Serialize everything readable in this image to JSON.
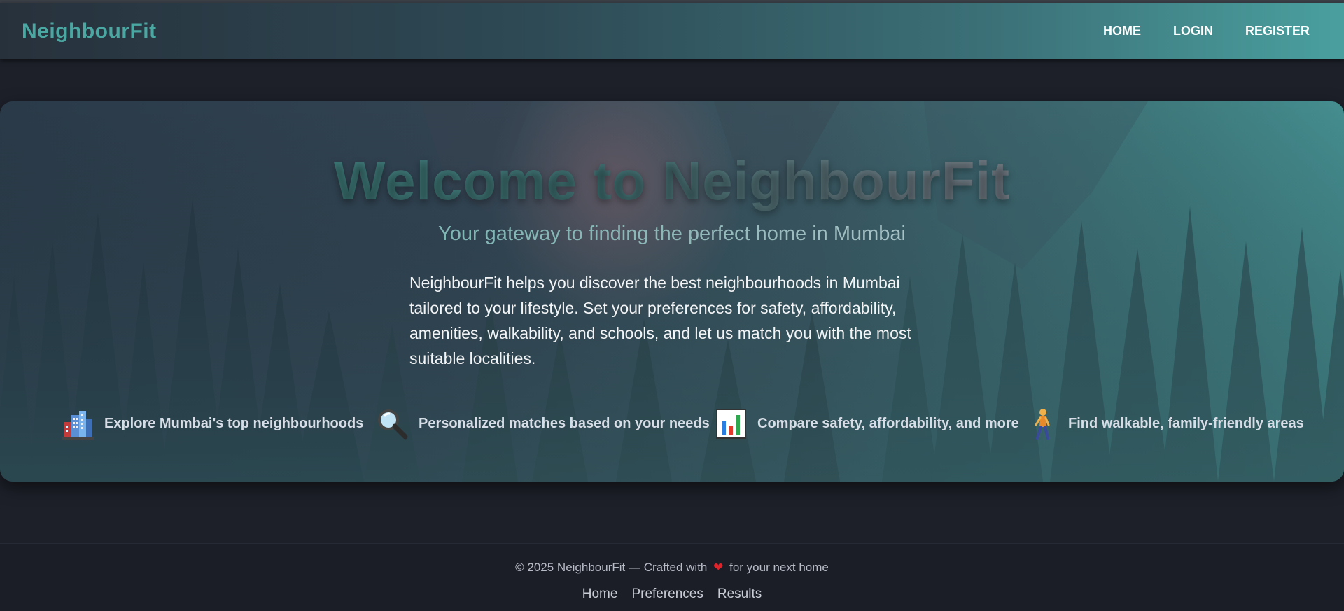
{
  "navbar": {
    "brand": "NeighbourFit",
    "links": [
      "HOME",
      "LOGIN",
      "REGISTER"
    ]
  },
  "hero": {
    "title": "Welcome to NeighbourFit",
    "subtitle": "Your gateway to finding the perfect home in Mumbai",
    "description": "NeighbourFit helps you discover the best neighbourhoods in Mumbai tailored to your lifestyle. Set your preferences for safety, affordability, amenities, walkability, and schools, and let us match you with the most suitable localities.",
    "features": [
      {
        "icon": "city-buildings-icon",
        "label": "Explore Mumbai's top neighbourhoods"
      },
      {
        "icon": "magnifying-glass-icon",
        "label": "Personalized matches based on your needs"
      },
      {
        "icon": "bar-chart-icon",
        "label": "Compare safety, affordability, and more"
      },
      {
        "icon": "person-walking-icon",
        "label": "Find walkable, family-friendly areas"
      }
    ]
  },
  "footer": {
    "copyright_prefix": "© 2025 NeighbourFit — Crafted with",
    "heart": "❤",
    "copyright_suffix": "for your next home",
    "links": [
      "Home",
      "Preferences",
      "Results"
    ]
  },
  "colors": {
    "brand": "#4aa7a2",
    "heart": "#e0242b",
    "page_bg": "#1d2029"
  }
}
